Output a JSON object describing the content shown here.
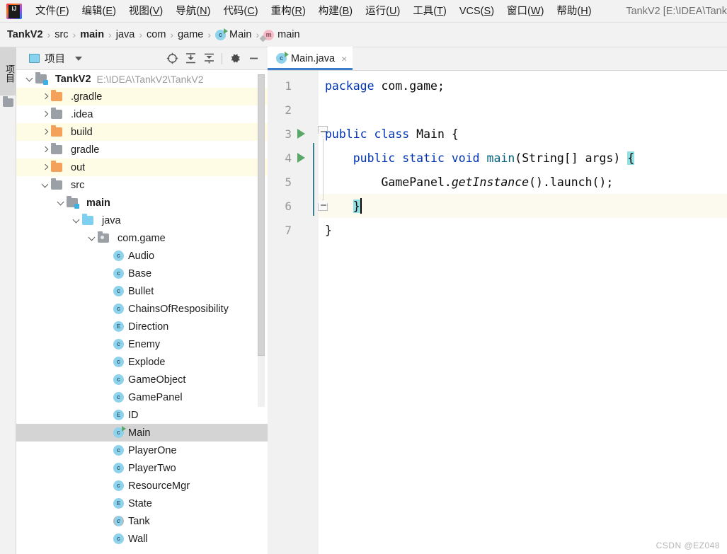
{
  "menubar": {
    "logo": "intellij-idea-logo",
    "items": [
      {
        "label": "文件(F)",
        "mnemonic": "F"
      },
      {
        "label": "编辑(E)",
        "mnemonic": "E"
      },
      {
        "label": "视图(V)",
        "mnemonic": "V"
      },
      {
        "label": "导航(N)",
        "mnemonic": "N"
      },
      {
        "label": "代码(C)",
        "mnemonic": "C"
      },
      {
        "label": "重构(R)",
        "mnemonic": "R"
      },
      {
        "label": "构建(B)",
        "mnemonic": "B"
      },
      {
        "label": "运行(U)",
        "mnemonic": "U"
      },
      {
        "label": "工具(T)",
        "mnemonic": "T"
      },
      {
        "label": "VCS(S)",
        "mnemonic": "S"
      },
      {
        "label": "窗口(W)",
        "mnemonic": "W"
      },
      {
        "label": "帮助(H)",
        "mnemonic": "H"
      }
    ],
    "window_title": "TankV2 [E:\\IDEA\\Tank"
  },
  "breadcrumb": {
    "separator": "›",
    "items": [
      {
        "label": "TankV2",
        "bold": true,
        "icon": null
      },
      {
        "label": "src",
        "bold": false,
        "icon": null
      },
      {
        "label": "main",
        "bold": true,
        "icon": null
      },
      {
        "label": "java",
        "bold": false,
        "icon": null
      },
      {
        "label": "com",
        "bold": false,
        "icon": null
      },
      {
        "label": "game",
        "bold": false,
        "icon": null
      },
      {
        "label": "Main",
        "bold": false,
        "icon": "class-run-icon"
      },
      {
        "label": "main",
        "bold": false,
        "icon": "method-icon"
      }
    ]
  },
  "left_toolbar": {
    "project_tab_label": "项目",
    "folder_icon": "folder-icon"
  },
  "project_panel": {
    "title": "项目",
    "title_icon": "project-window-icon",
    "dropdown_icon": "chevron-down-icon",
    "toolbar_buttons": [
      {
        "name": "select-opened-file-icon",
        "glyph": "target"
      },
      {
        "name": "expand-all-icon",
        "glyph": "expand"
      },
      {
        "name": "collapse-all-icon",
        "glyph": "collapse"
      },
      {
        "name": "settings-gear-icon",
        "glyph": "gear"
      },
      {
        "name": "hide-panel-icon",
        "glyph": "minus"
      }
    ],
    "tree": [
      {
        "label": "TankV2",
        "path": "E:\\IDEA\\TankV2\\TankV2",
        "indent": 0,
        "expander": "down",
        "icon": "module-folder",
        "bold": true,
        "excluded": false,
        "selected": false
      },
      {
        "label": ".gradle",
        "path": "",
        "indent": 1,
        "expander": "right",
        "icon": "folder-orange",
        "bold": false,
        "excluded": true,
        "selected": false
      },
      {
        "label": ".idea",
        "path": "",
        "indent": 1,
        "expander": "right",
        "icon": "folder-gray",
        "bold": false,
        "excluded": false,
        "selected": false
      },
      {
        "label": "build",
        "path": "",
        "indent": 1,
        "expander": "right",
        "icon": "folder-orange",
        "bold": false,
        "excluded": true,
        "selected": false
      },
      {
        "label": "gradle",
        "path": "",
        "indent": 1,
        "expander": "right",
        "icon": "folder-gray",
        "bold": false,
        "excluded": false,
        "selected": false
      },
      {
        "label": "out",
        "path": "",
        "indent": 1,
        "expander": "right",
        "icon": "folder-orange",
        "bold": false,
        "excluded": true,
        "selected": false
      },
      {
        "label": "src",
        "path": "",
        "indent": 1,
        "expander": "down",
        "icon": "folder-gray",
        "bold": false,
        "excluded": false,
        "selected": false
      },
      {
        "label": "main",
        "path": "",
        "indent": 2,
        "expander": "down",
        "icon": "module-folder",
        "bold": true,
        "excluded": false,
        "selected": false
      },
      {
        "label": "java",
        "path": "",
        "indent": 3,
        "expander": "down",
        "icon": "folder-blue",
        "bold": false,
        "excluded": false,
        "selected": false
      },
      {
        "label": "com.game",
        "path": "",
        "indent": 4,
        "expander": "down",
        "icon": "package-folder",
        "bold": false,
        "excluded": false,
        "selected": false
      },
      {
        "label": "Audio",
        "path": "",
        "indent": 5,
        "expander": "none",
        "icon": "class-icon",
        "bold": false,
        "excluded": false,
        "selected": false
      },
      {
        "label": "Base",
        "path": "",
        "indent": 5,
        "expander": "none",
        "icon": "class-icon",
        "bold": false,
        "excluded": false,
        "selected": false
      },
      {
        "label": "Bullet",
        "path": "",
        "indent": 5,
        "expander": "none",
        "icon": "class-icon",
        "bold": false,
        "excluded": false,
        "selected": false
      },
      {
        "label": "ChainsOfResposibility",
        "path": "",
        "indent": 5,
        "expander": "none",
        "icon": "class-icon",
        "bold": false,
        "excluded": false,
        "selected": false
      },
      {
        "label": "Direction",
        "path": "",
        "indent": 5,
        "expander": "none",
        "icon": "enum-icon",
        "bold": false,
        "excluded": false,
        "selected": false
      },
      {
        "label": "Enemy",
        "path": "",
        "indent": 5,
        "expander": "none",
        "icon": "class-icon",
        "bold": false,
        "excluded": false,
        "selected": false
      },
      {
        "label": "Explode",
        "path": "",
        "indent": 5,
        "expander": "none",
        "icon": "class-icon",
        "bold": false,
        "excluded": false,
        "selected": false
      },
      {
        "label": "GameObject",
        "path": "",
        "indent": 5,
        "expander": "none",
        "icon": "class-icon",
        "bold": false,
        "excluded": false,
        "selected": false
      },
      {
        "label": "GamePanel",
        "path": "",
        "indent": 5,
        "expander": "none",
        "icon": "class-icon",
        "bold": false,
        "excluded": false,
        "selected": false
      },
      {
        "label": "ID",
        "path": "",
        "indent": 5,
        "expander": "none",
        "icon": "enum-icon",
        "bold": false,
        "excluded": false,
        "selected": false
      },
      {
        "label": "Main",
        "path": "",
        "indent": 5,
        "expander": "none",
        "icon": "class-run-icon",
        "bold": false,
        "excluded": false,
        "selected": true
      },
      {
        "label": "PlayerOne",
        "path": "",
        "indent": 5,
        "expander": "none",
        "icon": "class-icon",
        "bold": false,
        "excluded": false,
        "selected": false
      },
      {
        "label": "PlayerTwo",
        "path": "",
        "indent": 5,
        "expander": "none",
        "icon": "class-icon",
        "bold": false,
        "excluded": false,
        "selected": false
      },
      {
        "label": "ResourceMgr",
        "path": "",
        "indent": 5,
        "expander": "none",
        "icon": "class-icon",
        "bold": false,
        "excluded": false,
        "selected": false
      },
      {
        "label": "State",
        "path": "",
        "indent": 5,
        "expander": "none",
        "icon": "enum-icon",
        "bold": false,
        "excluded": false,
        "selected": false
      },
      {
        "label": "Tank",
        "path": "",
        "indent": 5,
        "expander": "none",
        "icon": "abstract-class-icon",
        "bold": false,
        "excluded": false,
        "selected": false
      },
      {
        "label": "Wall",
        "path": "",
        "indent": 5,
        "expander": "none",
        "icon": "class-icon",
        "bold": false,
        "excluded": false,
        "selected": false
      }
    ]
  },
  "editor": {
    "tabs": [
      {
        "label": "Main.java",
        "icon": "class-run-icon",
        "close_glyph": "×",
        "active": true
      }
    ],
    "line_numbers": [
      "1",
      "2",
      "3",
      "4",
      "5",
      "6",
      "7"
    ],
    "run_arrow_lines": [
      3,
      4
    ],
    "current_line": 6,
    "code_lines": [
      {
        "num": 1,
        "segments": [
          {
            "t": "package",
            "c": "k"
          },
          {
            "t": " com.game;",
            "c": ""
          }
        ]
      },
      {
        "num": 2,
        "segments": []
      },
      {
        "num": 3,
        "segments": [
          {
            "t": "public",
            "c": "k"
          },
          {
            "t": " ",
            "c": ""
          },
          {
            "t": "class",
            "c": "k"
          },
          {
            "t": " Main {",
            "c": ""
          }
        ]
      },
      {
        "num": 4,
        "segments": [
          {
            "t": "    ",
            "c": ""
          },
          {
            "t": "public",
            "c": "k"
          },
          {
            "t": " ",
            "c": ""
          },
          {
            "t": "static",
            "c": "k"
          },
          {
            "t": " ",
            "c": ""
          },
          {
            "t": "void",
            "c": "k"
          },
          {
            "t": " ",
            "c": ""
          },
          {
            "t": "main",
            "c": "mn"
          },
          {
            "t": "(String[] args) ",
            "c": ""
          },
          {
            "t": "{",
            "c": "brace-hl"
          }
        ]
      },
      {
        "num": 5,
        "segments": [
          {
            "t": "        GamePanel.",
            "c": ""
          },
          {
            "t": "getInstance",
            "c": "it"
          },
          {
            "t": "().launch();",
            "c": ""
          }
        ]
      },
      {
        "num": 6,
        "segments": [
          {
            "t": "    ",
            "c": ""
          },
          {
            "t": "}",
            "c": "brace-hl"
          }
        ]
      },
      {
        "num": 7,
        "segments": [
          {
            "t": "}",
            "c": ""
          }
        ]
      }
    ]
  },
  "watermark": "CSDN @EZ048",
  "colors": {
    "keyword": "#0033B3",
    "method_name": "#00627A",
    "brace_highlight": "#93E0E3",
    "current_line_bg": "#FCFAEF",
    "excluded_row_bg": "#FFFCE5",
    "selection_bg": "#D4D4D4",
    "run_green": "#59A869",
    "tab_underline": "#3D7ECC",
    "class_icon": "#8ED2EC",
    "folder_orange": "#F4A15B"
  }
}
